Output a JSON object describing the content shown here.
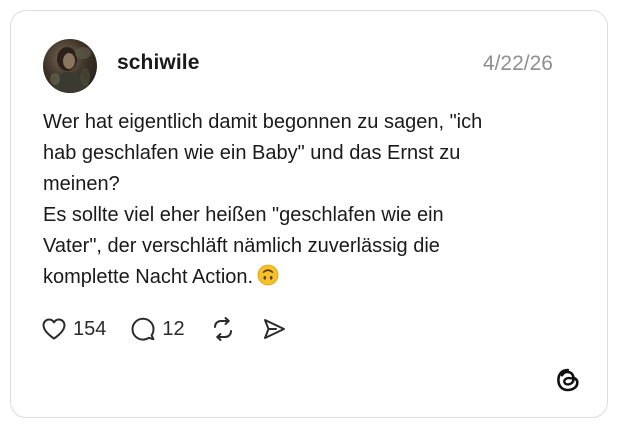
{
  "post": {
    "username": "schiwile",
    "date": "4/22/26",
    "text": "Wer hat eigentlich damit begonnen zu sagen, \"ich\nhab geschlafen wie ein Baby\" und das Ernst zu\nmeinen?\nEs sollte viel eher heißen \"geschlafen wie ein\nVater\", der verschläft nämlich zuverlässig die\nkomplette Nacht Action.",
    "emoji": "upside-down-face-emoji"
  },
  "actions": {
    "likes": "154",
    "replies": "12",
    "icons": [
      "heart-icon",
      "comment-icon",
      "repost-icon",
      "share-icon"
    ]
  },
  "brand": {
    "logo": "threads-logo-icon"
  },
  "colors": {
    "text": "#1a1a1a",
    "muted": "#8f8f8f",
    "border": "#dcdcdc",
    "emoji": "#f5c02a"
  }
}
